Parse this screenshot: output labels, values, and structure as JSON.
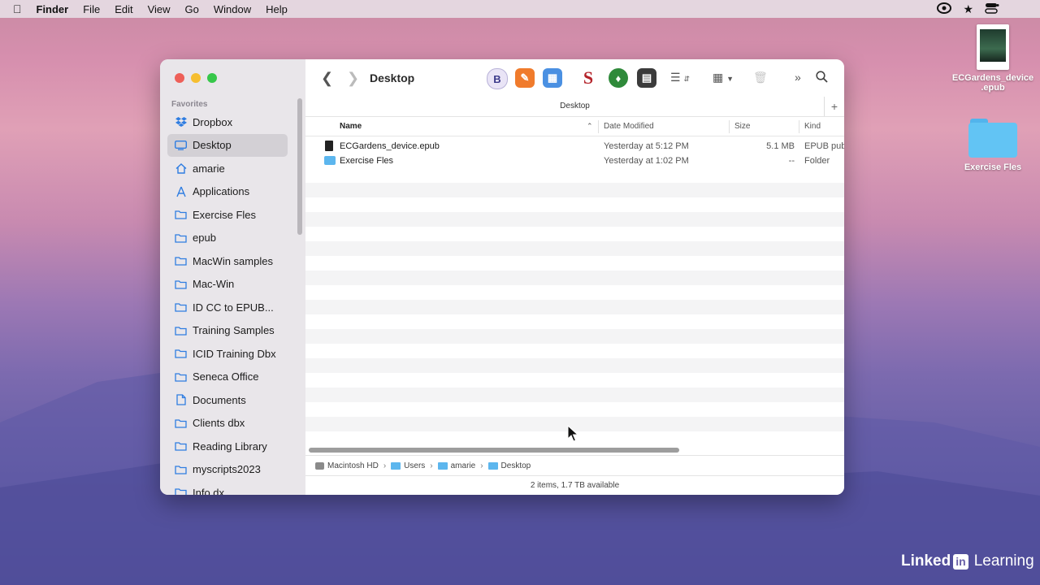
{
  "menubar": {
    "items": [
      "Finder",
      "File",
      "Edit",
      "View",
      "Go",
      "Window",
      "Help"
    ]
  },
  "desktop": {
    "icons": [
      {
        "label": ".epub",
        "label_line1": "ECGardens_device"
      },
      {
        "label": "Exercise Fles"
      }
    ]
  },
  "sidebar": {
    "heading": "Favorites",
    "items": [
      {
        "label": "Dropbox",
        "icon": "dropbox-icon"
      },
      {
        "label": "Desktop",
        "icon": "desktop-icon",
        "selected": true
      },
      {
        "label": "amarie",
        "icon": "home-icon"
      },
      {
        "label": "Applications",
        "icon": "applications-icon"
      },
      {
        "label": "Exercise Fles",
        "icon": "folder-icon"
      },
      {
        "label": "epub",
        "icon": "folder-icon"
      },
      {
        "label": "MacWin samples",
        "icon": "folder-icon"
      },
      {
        "label": "Mac-Win",
        "icon": "folder-icon"
      },
      {
        "label": "ID CC to EPUB...",
        "icon": "folder-icon"
      },
      {
        "label": "Training Samples",
        "icon": "folder-icon"
      },
      {
        "label": "ICID Training Dbx",
        "icon": "folder-icon"
      },
      {
        "label": "Seneca Office",
        "icon": "folder-icon"
      },
      {
        "label": "Documents",
        "icon": "document-icon"
      },
      {
        "label": "Clients dbx",
        "icon": "folder-icon"
      },
      {
        "label": "Reading Library",
        "icon": "folder-icon"
      },
      {
        "label": "myscripts2023",
        "icon": "folder-icon"
      },
      {
        "label": "Info dx",
        "icon": "folder-icon"
      }
    ]
  },
  "toolbar": {
    "title": "Desktop",
    "tab_title": "Desktop"
  },
  "columns": {
    "name": "Name",
    "date_modified": "Date Modified",
    "size": "Size",
    "kind": "Kind"
  },
  "files": [
    {
      "name": "ECGardens_device.epub",
      "date": "Yesterday at 5:12 PM",
      "size": "5.1 MB",
      "kind": "EPUB pub",
      "type": "file"
    },
    {
      "name": "Exercise Fles",
      "date": "Yesterday at 1:02 PM",
      "size": "--",
      "kind": "Folder",
      "type": "folder"
    }
  ],
  "pathbar": {
    "segments": [
      "Macintosh HD",
      "Users",
      "amarie",
      "Desktop"
    ]
  },
  "status": {
    "text": "2 items, 1.7 TB available"
  },
  "watermark": {
    "linked": "Linked",
    "in": "in",
    "learning": "Learning"
  }
}
